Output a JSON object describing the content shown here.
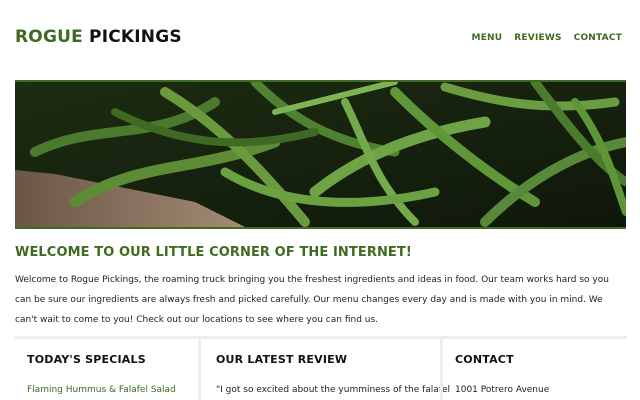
{
  "header": {
    "logo_accent": "ROGUE",
    "logo_rest": "PICKINGS",
    "nav": [
      "MENU",
      "REVIEWS",
      "CONTACT"
    ]
  },
  "hero": {
    "alt": "green beans"
  },
  "welcome": {
    "title": "WELCOME TO OUR LITTLE CORNER OF THE INTERNET!",
    "body": "Welcome to Rogue Pickings, the roaming truck bringing you the freshest ingredients and ideas in food. Our team works hard so you can be sure our ingredients are always fresh and picked carefully. Our menu changes every day and is made with you in mind. We can't wait to come to you! Check out our locations to see where you can find us."
  },
  "specials": {
    "title": "TODAY'S SPECIALS",
    "first_item": "Flaming Hummus & Falafel Salad"
  },
  "review": {
    "title": "OUR LATEST REVIEW",
    "excerpt": "\"I got so excited about the yumminess of the falafel"
  },
  "contact": {
    "title": "CONTACT",
    "address_line1": "1001 Potrero Avenue"
  },
  "colors": {
    "accent": "#3f6a1f",
    "divider": "#eeeeee"
  }
}
